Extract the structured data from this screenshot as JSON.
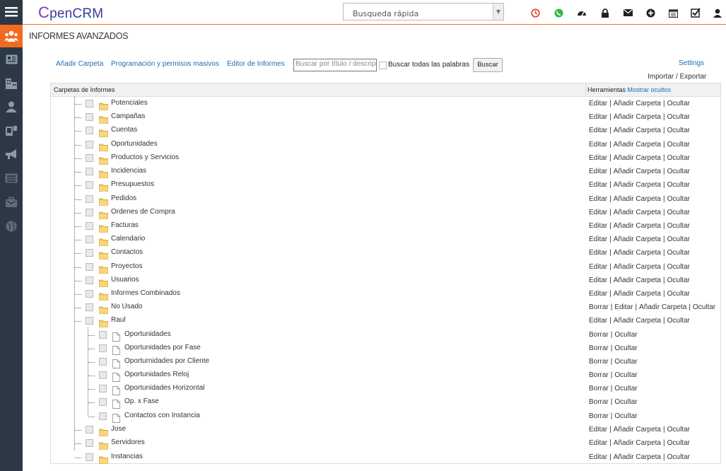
{
  "app": {
    "logo_c": "C",
    "logo_rest": "penCRM"
  },
  "quick_search": {
    "placeholder": "Busqueda rápida"
  },
  "sidebar": {
    "items": [
      "menu-icon",
      "users-icon",
      "contact-card-icon",
      "buildings-icon",
      "person-icon",
      "phone-card-icon",
      "megaphone-icon",
      "list-icon",
      "briefcase-mail-icon",
      "globe-icon"
    ]
  },
  "header_icons": [
    "clock-icon",
    "whatsapp-icon",
    "dashboard-icon",
    "lock-icon",
    "envelope-icon",
    "plus-circle-icon",
    "calendar-icon",
    "checkbox-icon",
    "user-icon"
  ],
  "page": {
    "title": "INFORMES AVANZADOS"
  },
  "toolbar": {
    "add_folder": "Añadir Carpeta",
    "schedule": "Programación y permisos masivos",
    "editor": "Editor de Informes",
    "search_placeholder": "Buscar por título / descripción",
    "all_words": "Buscar todas las palabras",
    "search_button": "Buscar",
    "settings": "Settings",
    "import_export": "Importar / Exportar"
  },
  "table": {
    "header_folders": "Carpetas de Informes",
    "header_tools": "Herramientas",
    "show_hidden": "Mostrar ocultos"
  },
  "rows": [
    {
      "label": "Potenciales",
      "level": 0,
      "type": "folder",
      "tools": [
        "Editar",
        "Añadir Carpeta",
        "Ocultar"
      ]
    },
    {
      "label": "Campañas",
      "level": 0,
      "type": "folder",
      "tools": [
        "Editar",
        "Añadir Carpeta",
        "Ocultar"
      ]
    },
    {
      "label": "Cuentas",
      "level": 0,
      "type": "folder",
      "tools": [
        "Editar",
        "Añadir Carpeta",
        "Ocultar"
      ]
    },
    {
      "label": "Oportunidades",
      "level": 0,
      "type": "folder",
      "tools": [
        "Editar",
        "Añadir Carpeta",
        "Ocultar"
      ]
    },
    {
      "label": "Productos y Servicios",
      "level": 0,
      "type": "folder",
      "tools": [
        "Editar",
        "Añadir Carpeta",
        "Ocultar"
      ]
    },
    {
      "label": "Incidencias",
      "level": 0,
      "type": "folder",
      "tools": [
        "Editar",
        "Añadir Carpeta",
        "Ocultar"
      ]
    },
    {
      "label": "Presupuestos",
      "level": 0,
      "type": "folder",
      "tools": [
        "Editar",
        "Añadir Carpeta",
        "Ocultar"
      ]
    },
    {
      "label": "Pedidos",
      "level": 0,
      "type": "folder",
      "tools": [
        "Editar",
        "Añadir Carpeta",
        "Ocultar"
      ]
    },
    {
      "label": "Ordenes de Compra",
      "level": 0,
      "type": "folder",
      "tools": [
        "Editar",
        "Añadir Carpeta",
        "Ocultar"
      ]
    },
    {
      "label": "Facturas",
      "level": 0,
      "type": "folder",
      "tools": [
        "Editar",
        "Añadir Carpeta",
        "Ocultar"
      ]
    },
    {
      "label": "Calendario",
      "level": 0,
      "type": "folder",
      "tools": [
        "Editar",
        "Añadir Carpeta",
        "Ocultar"
      ]
    },
    {
      "label": "Contactos",
      "level": 0,
      "type": "folder",
      "tools": [
        "Editar",
        "Añadir Carpeta",
        "Ocultar"
      ]
    },
    {
      "label": "Proyectos",
      "level": 0,
      "type": "folder",
      "tools": [
        "Editar",
        "Añadir Carpeta",
        "Ocultar"
      ]
    },
    {
      "label": "Usuarios",
      "level": 0,
      "type": "folder",
      "tools": [
        "Editar",
        "Añadir Carpeta",
        "Ocultar"
      ]
    },
    {
      "label": "Informes Combinados",
      "level": 0,
      "type": "folder",
      "tools": [
        "Editar",
        "Añadir Carpeta",
        "Ocultar"
      ]
    },
    {
      "label": "No Usado",
      "level": 0,
      "type": "folder",
      "tools": [
        "Borrar",
        "Editar",
        "Añadir Carpeta",
        "Ocultar"
      ]
    },
    {
      "label": "Raul",
      "level": 0,
      "type": "folder",
      "tools": [
        "Editar",
        "Añadir Carpeta",
        "Ocultar"
      ]
    },
    {
      "label": "Oportunidades",
      "level": 1,
      "type": "report",
      "tools": [
        "Borrar",
        "Ocultar"
      ]
    },
    {
      "label": "Oportunidades por Fase",
      "level": 1,
      "type": "report",
      "tools": [
        "Borrar",
        "Ocultar"
      ]
    },
    {
      "label": "Oporturnidades por Cliente",
      "level": 1,
      "type": "report",
      "tools": [
        "Borrar",
        "Ocultar"
      ]
    },
    {
      "label": "Oportunidades Reloj",
      "level": 1,
      "type": "report",
      "tools": [
        "Borrar",
        "Ocultar"
      ]
    },
    {
      "label": "Oportunidades Horizontal",
      "level": 1,
      "type": "report",
      "tools": [
        "Borrar",
        "Ocultar"
      ]
    },
    {
      "label": "Op. x Fase",
      "level": 1,
      "type": "report",
      "tools": [
        "Borrar",
        "Ocultar"
      ]
    },
    {
      "label": "Contactos con Instancia",
      "level": 1,
      "type": "report",
      "tools": [
        "Borrar",
        "Ocultar"
      ]
    },
    {
      "label": "Jose",
      "level": 0,
      "type": "folder",
      "tools": [
        "Editar",
        "Añadir Carpeta",
        "Ocultar"
      ]
    },
    {
      "label": "Servidores",
      "level": 0,
      "type": "folder",
      "tools": [
        "Editar",
        "Añadir Carpeta",
        "Ocultar"
      ]
    },
    {
      "label": "Instancias",
      "level": 0,
      "type": "folder",
      "tools": [
        "Editar",
        "Añadir Carpeta",
        "Ocultar"
      ]
    }
  ],
  "colors": {
    "sidebar": "#2c3945",
    "accent": "#f26b21",
    "link": "#1f6bb5"
  }
}
